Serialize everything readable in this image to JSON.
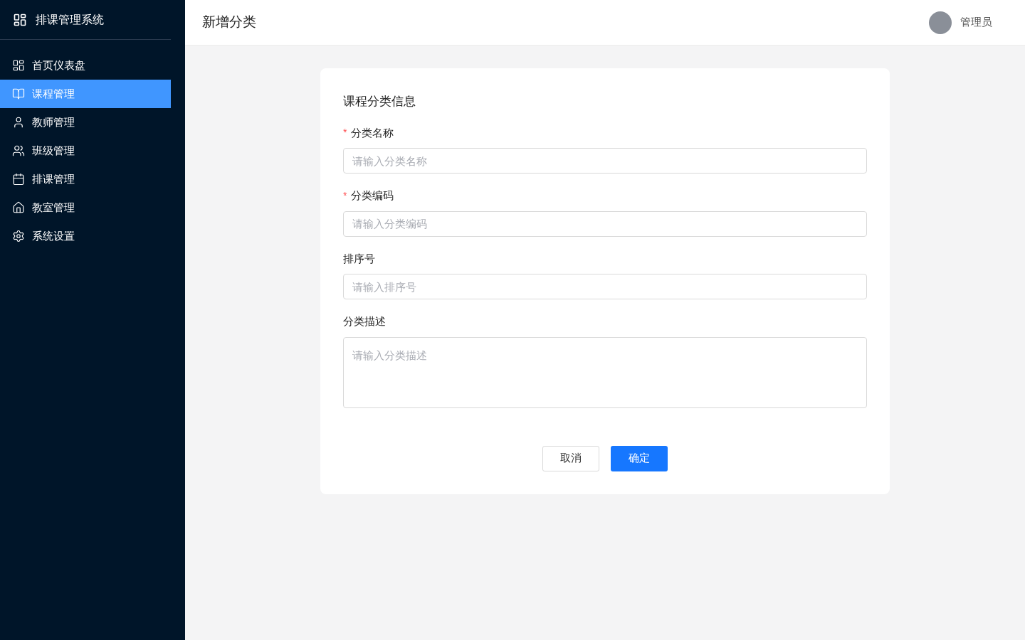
{
  "sidebar": {
    "title": "排课管理系统",
    "items": [
      {
        "label": "首页仪表盘",
        "kind": "dashboard",
        "selected": false
      },
      {
        "label": "课程管理",
        "kind": "book",
        "selected": true
      },
      {
        "label": "教师管理",
        "kind": "user",
        "selected": false
      },
      {
        "label": "班级管理",
        "kind": "team",
        "selected": false
      },
      {
        "label": "排课管理",
        "kind": "calendar",
        "selected": false
      },
      {
        "label": "教室管理",
        "kind": "home",
        "selected": false
      },
      {
        "label": "系统设置",
        "kind": "settings",
        "selected": false
      }
    ]
  },
  "header": {
    "title": "新增分类",
    "user": "管理员"
  },
  "form": {
    "title": "课程分类信息",
    "fields": [
      {
        "mark": "*",
        "label": "分类名称",
        "kind": "input",
        "placeholder": "请输入分类名称"
      },
      {
        "mark": "*",
        "label": "分类编码",
        "kind": "input",
        "placeholder": "请输入分类编码"
      },
      {
        "label": "排序号",
        "kind": "input",
        "placeholder": "请输入排序号"
      },
      {
        "label": "分类描述",
        "kind": "textarea",
        "placeholder": "请输入分类描述"
      }
    ],
    "buttons": [
      {
        "label": "取消",
        "kind": "default"
      },
      {
        "label": "确定",
        "kind": "primary"
      }
    ]
  }
}
